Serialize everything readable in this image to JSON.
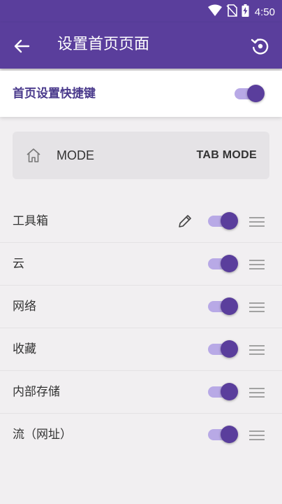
{
  "status_bar": {
    "time": "4:50",
    "icons": [
      "wifi-icon",
      "no-sim-icon",
      "battery-charging-icon"
    ]
  },
  "app_bar": {
    "title": "设置首页页面",
    "back_icon": "arrow-left-icon",
    "restore_icon": "restore-icon"
  },
  "shortcut": {
    "label": "首页设置快捷键",
    "enabled": true
  },
  "mode_card": {
    "icon": "home-icon",
    "label": "MODE",
    "action_label": "TAB MODE"
  },
  "items": [
    {
      "label": "工具箱",
      "enabled": true,
      "editable": true
    },
    {
      "label": "云",
      "enabled": true,
      "editable": false
    },
    {
      "label": "网络",
      "enabled": true,
      "editable": false
    },
    {
      "label": "收藏",
      "enabled": true,
      "editable": false
    },
    {
      "label": "内部存储",
      "enabled": true,
      "editable": false
    },
    {
      "label": "流（网址）",
      "enabled": true,
      "editable": false
    }
  ],
  "colors": {
    "primary": "#5a3e9c",
    "toggle_track": "#b8a9e6",
    "background": "#f1eff1",
    "card": "#e5e3e6"
  }
}
